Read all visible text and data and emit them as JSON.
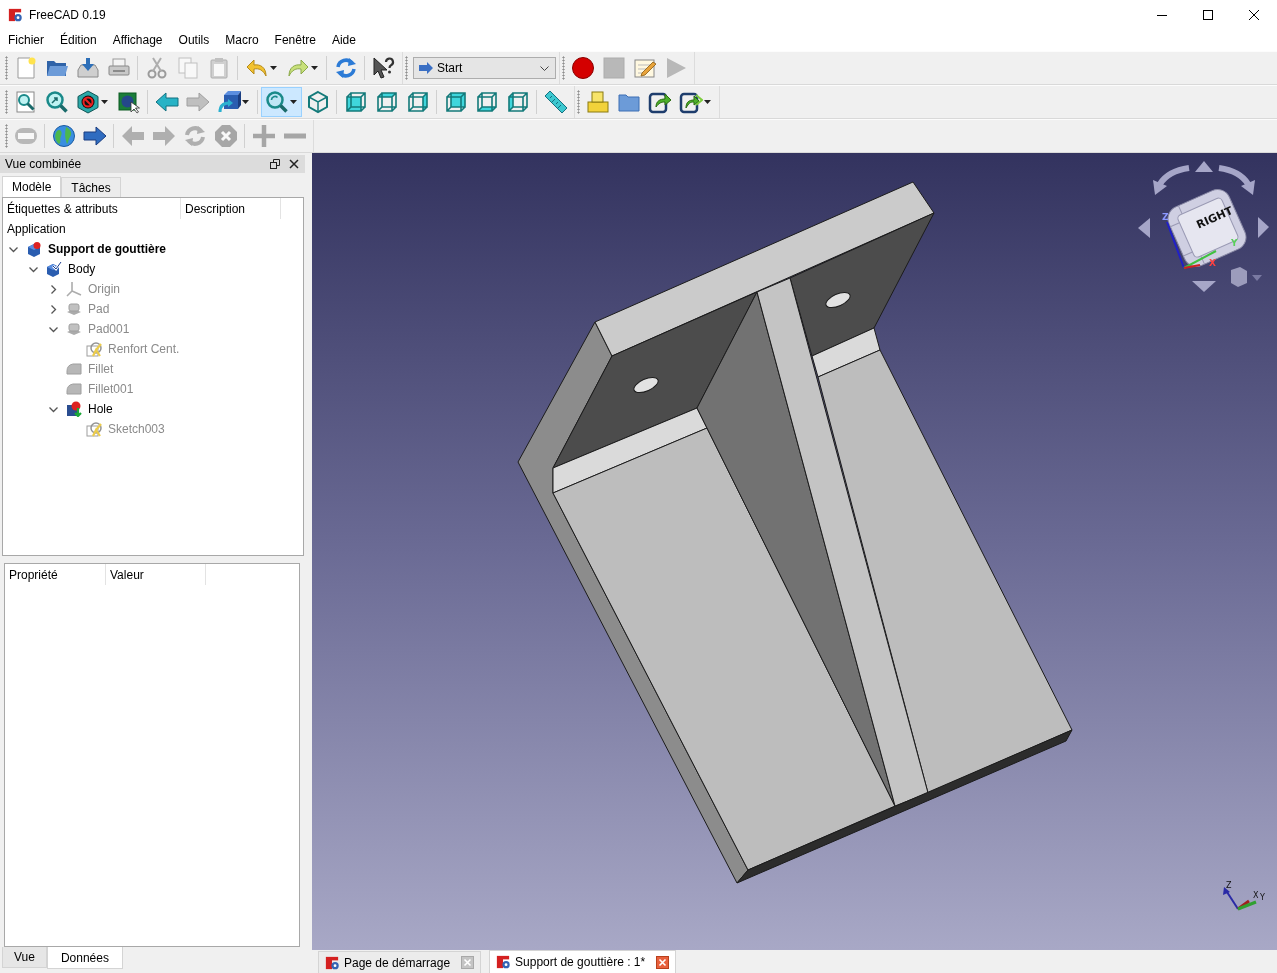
{
  "window": {
    "title": "FreeCAD 0.19"
  },
  "menu": [
    "Fichier",
    "Édition",
    "Affichage",
    "Outils",
    "Macro",
    "Fenêtre",
    "Aide"
  ],
  "toolbar_rows": [
    [
      {
        "groups": [
          [
            {
              "kind": "new",
              "disabled": false,
              "pressed": false
            },
            {
              "kind": "open",
              "disabled": false,
              "pressed": false
            },
            {
              "kind": "save",
              "disabled": false,
              "pressed": false
            },
            {
              "kind": "print",
              "disabled": false,
              "pressed": false
            }
          ],
          [
            {
              "kind": "cut",
              "disabled": true,
              "pressed": false
            },
            {
              "kind": "copy",
              "disabled": true,
              "pressed": false
            },
            {
              "kind": "paste",
              "disabled": true,
              "pressed": false
            }
          ],
          [
            {
              "kind": "undo",
              "disabled": false,
              "pressed": false,
              "menu": true
            },
            {
              "kind": "redo",
              "disabled": false,
              "pressed": false,
              "menu": true
            }
          ],
          [
            {
              "kind": "refresh",
              "disabled": false,
              "pressed": false
            }
          ],
          [
            {
              "kind": "whatsthis",
              "disabled": false,
              "pressed": false
            }
          ]
        ]
      },
      {
        "groups": [
          [
            {
              "kind": "combo",
              "value": "Start",
              "disabled": false
            }
          ]
        ]
      },
      {
        "groups": [
          [
            {
              "kind": "record",
              "disabled": false,
              "pressed": false
            },
            {
              "kind": "stop",
              "disabled": true,
              "pressed": false
            },
            {
              "kind": "macro",
              "disabled": false,
              "pressed": false
            },
            {
              "kind": "play",
              "disabled": true,
              "pressed": false
            }
          ]
        ]
      }
    ],
    [
      {
        "groups": [
          [
            {
              "kind": "fitall",
              "disabled": false,
              "pressed": false
            },
            {
              "kind": "fitselection",
              "disabled": false,
              "pressed": false
            },
            {
              "kind": "drawstyle",
              "disabled": false,
              "pressed": false,
              "menu": true
            },
            {
              "kind": "selbox",
              "disabled": false,
              "pressed": false
            }
          ],
          [
            {
              "kind": "back",
              "disabled": false,
              "pressed": false
            },
            {
              "kind": "forward",
              "disabled": true,
              "pressed": false
            },
            {
              "kind": "dock",
              "disabled": false,
              "pressed": false,
              "menu": true
            }
          ],
          [
            {
              "kind": "boxzoom",
              "disabled": false,
              "pressed": true,
              "menu": true
            },
            {
              "kind": "isometric",
              "disabled": false,
              "pressed": false
            }
          ],
          [
            {
              "kind": "front",
              "disabled": false,
              "pressed": false
            },
            {
              "kind": "top",
              "disabled": false,
              "pressed": false
            },
            {
              "kind": "right",
              "disabled": false,
              "pressed": false
            }
          ],
          [
            {
              "kind": "rear",
              "disabled": false,
              "pressed": false
            },
            {
              "kind": "bottom",
              "disabled": false,
              "pressed": false
            },
            {
              "kind": "left",
              "disabled": false,
              "pressed": false
            }
          ],
          [
            {
              "kind": "measure",
              "disabled": false,
              "pressed": false
            }
          ]
        ]
      },
      {
        "groups": [
          [
            {
              "kind": "part",
              "disabled": false,
              "pressed": false
            },
            {
              "kind": "group",
              "disabled": false,
              "pressed": false
            },
            {
              "kind": "link",
              "disabled": false,
              "pressed": false
            },
            {
              "kind": "linkactions",
              "disabled": false,
              "pressed": false,
              "menu": true
            }
          ]
        ]
      }
    ],
    [
      {
        "groups": [
          [
            {
              "kind": "browser",
              "disabled": true,
              "pressed": false
            }
          ],
          [
            {
              "kind": "globe",
              "disabled": false,
              "pressed": false
            },
            {
              "kind": "go",
              "disabled": false,
              "pressed": false
            }
          ],
          [
            {
              "kind": "webback",
              "disabled": true,
              "pressed": false
            },
            {
              "kind": "webforward",
              "disabled": true,
              "pressed": false
            },
            {
              "kind": "webrefresh",
              "disabled": true,
              "pressed": false
            },
            {
              "kind": "webstop",
              "disabled": true,
              "pressed": false
            }
          ],
          [
            {
              "kind": "zoomin",
              "disabled": true,
              "pressed": false
            },
            {
              "kind": "zoomout",
              "disabled": true,
              "pressed": false
            }
          ]
        ]
      }
    ]
  ],
  "combo_view": {
    "title": "Vue combinée",
    "tabs": [
      {
        "label": "Modèle",
        "selected": true
      },
      {
        "label": "Tâches",
        "selected": false
      }
    ],
    "tree": {
      "columns": [
        "Étiquettes & attributs",
        "Description"
      ],
      "root": "Application",
      "items": [
        {
          "label": "Support de gouttière",
          "kind": "document",
          "active": true,
          "hidden": false,
          "expanded": true,
          "children": [
            {
              "label": "Body",
              "kind": "body",
              "active": false,
              "hidden": false,
              "expanded": true,
              "children": [
                {
                  "label": "Origin",
                  "kind": "origin",
                  "active": false,
                  "hidden": true,
                  "expanded": false
                },
                {
                  "label": "Pad",
                  "kind": "pad",
                  "active": false,
                  "hidden": true,
                  "expanded": false
                },
                {
                  "label": "Pad001",
                  "kind": "pad",
                  "active": false,
                  "hidden": true,
                  "expanded": true,
                  "children": [
                    {
                      "label": "Renfort Cent.",
                      "kind": "sketch",
                      "active": false,
                      "hidden": true
                    }
                  ]
                },
                {
                  "label": "Fillet",
                  "kind": "fillet",
                  "active": false,
                  "hidden": true
                },
                {
                  "label": "Fillet001",
                  "kind": "fillet",
                  "active": false,
                  "hidden": true
                },
                {
                  "label": "Hole",
                  "kind": "hole",
                  "active": false,
                  "hidden": false,
                  "expanded": true,
                  "children": [
                    {
                      "label": "Sketch003",
                      "kind": "sketch",
                      "active": false,
                      "hidden": true
                    }
                  ]
                }
              ]
            }
          ]
        }
      ]
    },
    "properties": {
      "columns": [
        "Propriété",
        "Valeur"
      ],
      "tabs": [
        {
          "label": "Vue",
          "selected": false
        },
        {
          "label": "Données",
          "selected": true
        }
      ]
    }
  },
  "view3d": {
    "nav_cube": {
      "face_label": "RIGHT",
      "axis_labels": [
        "Z",
        "Y",
        "X"
      ]
    },
    "axis_cross": {
      "labels": [
        "Z",
        "X",
        "Y"
      ]
    }
  },
  "document_tabs": [
    {
      "label": "Page de démarrage",
      "selected": false
    },
    {
      "label": "Support de gouttière : 1*",
      "selected": true
    }
  ]
}
